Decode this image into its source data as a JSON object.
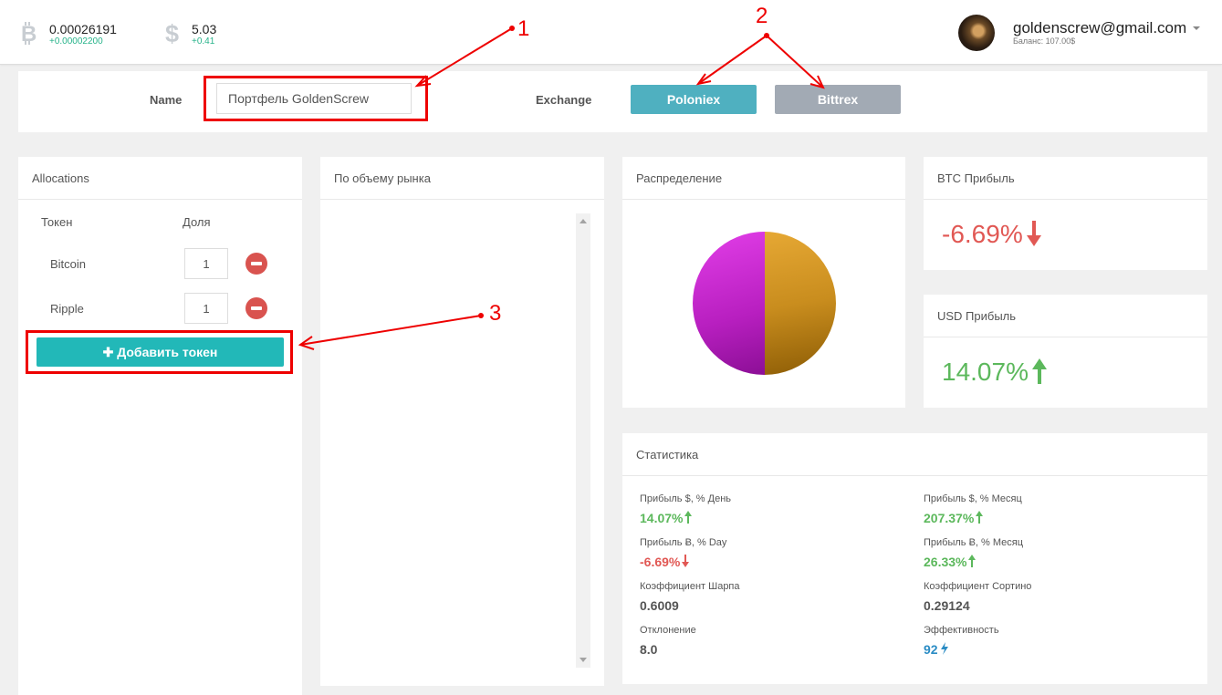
{
  "topbar": {
    "btc": {
      "value": "0.00026191",
      "change": "+0.00002200",
      "icon": "bitcoin-icon"
    },
    "usd": {
      "value": "5.03",
      "change": "+0.41",
      "icon": "dollar-icon"
    },
    "user": {
      "email": "goldenscrew@gmail.com",
      "balance": "Баланс: 107.00$"
    }
  },
  "portfolio": {
    "name_label": "Name",
    "name_value": "Портфель GoldenScrew",
    "exchange_label": "Exchange",
    "exchanges": [
      "Poloniex",
      "Bittrex"
    ],
    "selected_exchange": "Poloniex"
  },
  "allocations": {
    "title": "Allocations",
    "col_token": "Токен",
    "col_share": "Доля",
    "rows": [
      {
        "token": "Bitcoin",
        "share": "1"
      },
      {
        "token": "Ripple",
        "share": "1"
      }
    ],
    "add_button": "Добавить токен"
  },
  "market": {
    "title": "По объему рынка"
  },
  "distribution": {
    "title": "Распределение"
  },
  "btc_profit": {
    "title": "BTC Прибыль",
    "value": "-6.69%",
    "direction": "down"
  },
  "usd_profit": {
    "title": "USD Прибыль",
    "value": "14.07%",
    "direction": "up"
  },
  "stats": {
    "title": "Статистика",
    "items": [
      {
        "label": "Прибыль $, % День",
        "value": "14.07%",
        "trend": "up"
      },
      {
        "label": "Прибыль $, % Месяц",
        "value": "207.37%",
        "trend": "up"
      },
      {
        "label": "Прибыль Ƀ, % Day",
        "value": "-6.69%",
        "trend": "down"
      },
      {
        "label": "Прибыль Ƀ, % Месяц",
        "value": "26.33%",
        "trend": "up"
      },
      {
        "label": "Коэффициент Шарпа",
        "value": "0.6009",
        "trend": "none"
      },
      {
        "label": "Коэффициент Сортино",
        "value": "0.29124",
        "trend": "none"
      },
      {
        "label": "Отклонение",
        "value": "8.0",
        "trend": "none"
      },
      {
        "label": "Эффективность",
        "value": "92",
        "trend": "bolt"
      }
    ]
  },
  "annotations": {
    "n1": "1",
    "n2": "2",
    "n3": "3"
  },
  "colors": {
    "accent_teal": "#22b8b8",
    "poloniex": "#4fb0c0",
    "bittrex": "#a2aab4",
    "up": "#5cb85c",
    "down": "#e15854",
    "annotation": "#e00000"
  }
}
